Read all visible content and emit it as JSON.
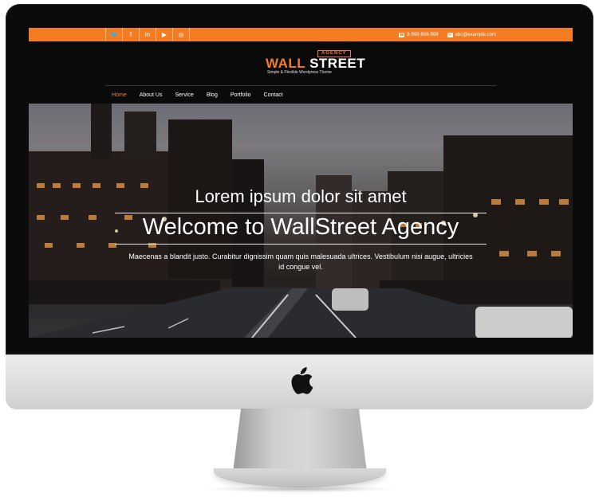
{
  "topbar": {
    "social_icons": [
      {
        "name": "twitter-icon",
        "glyph": "🐦"
      },
      {
        "name": "facebook-icon",
        "glyph": "f"
      },
      {
        "name": "linkedin-icon",
        "glyph": "in"
      },
      {
        "name": "youtube-icon",
        "glyph": "▶"
      },
      {
        "name": "instagram-icon",
        "glyph": "◎"
      }
    ],
    "phone": "9-999-999-999",
    "email": "abc@example.com"
  },
  "logo": {
    "tag": "AGENCY",
    "name_part1": "WALL",
    "name_part2": " STREET",
    "tagline": "Simple & Flexible Wordpress Theme"
  },
  "nav": {
    "items": [
      "Home",
      "About Us",
      "Service",
      "Blog",
      "Portfolio",
      "Contact"
    ],
    "active": "Home"
  },
  "hero": {
    "subtitle": "Lorem ipsum dolor sit amet",
    "title": "Welcome to WallStreet Agency",
    "text": "Maecenas a blandit justo. Curabitur dignissim quam quis malesuada ultrices. Vestibulum nisi augue, ultricies id congue vel."
  },
  "colors": {
    "accent": "#f47c22",
    "header_bg": "#0a0a0a"
  }
}
